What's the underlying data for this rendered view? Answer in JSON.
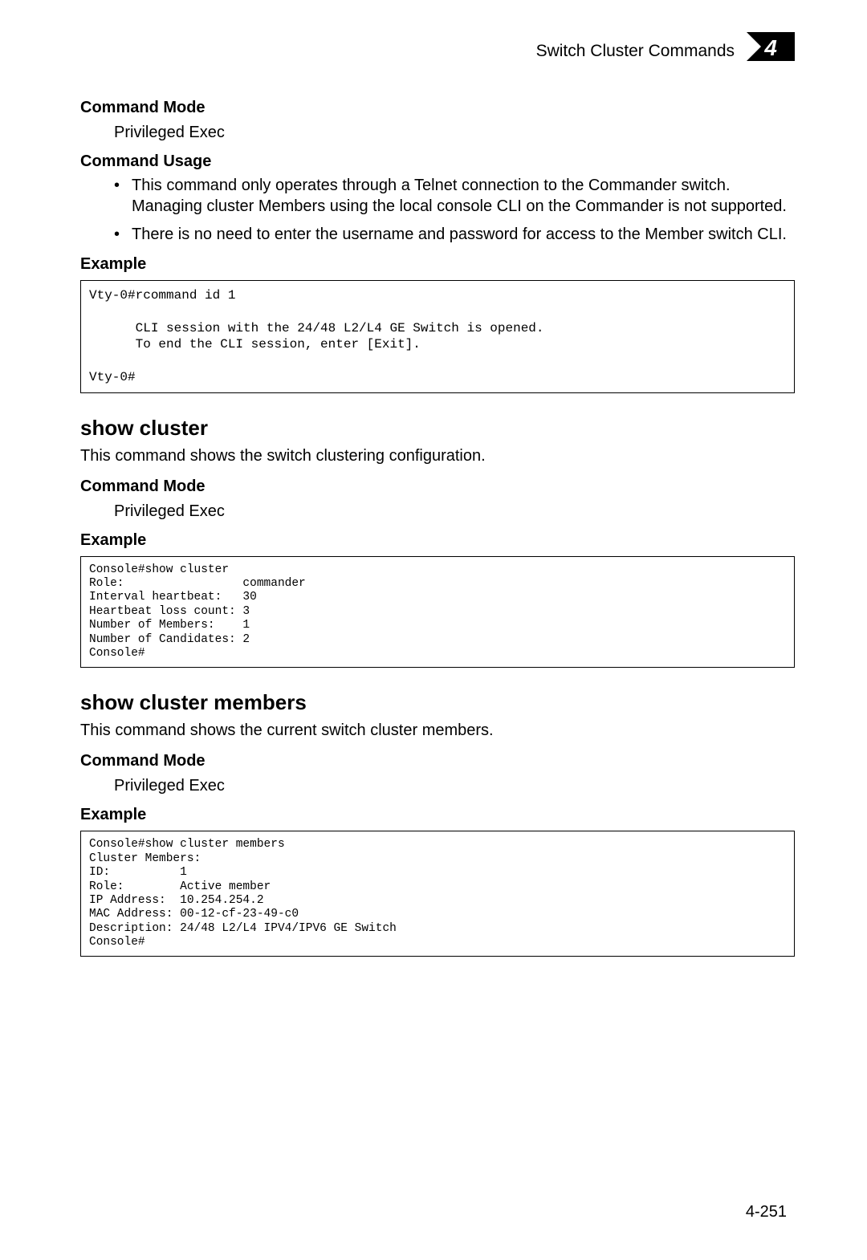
{
  "header": {
    "title": "Switch Cluster Commands",
    "chapter_number": "4"
  },
  "section1": {
    "command_mode_label": "Command Mode",
    "command_mode_value": "Privileged Exec",
    "command_usage_label": "Command Usage",
    "usage_bullets": [
      "This command only operates through a Telnet connection to the Commander switch. Managing cluster Members using the local console CLI on the Commander is not supported.",
      "There is no need to enter the username and password for access to the Member switch CLI."
    ],
    "example_label": "Example",
    "example_code": "Vty-0#rcommand id 1\n\n      CLI session with the 24/48 L2/L4 GE Switch is opened.\n      To end the CLI session, enter [Exit].\n\nVty-0#"
  },
  "section2": {
    "heading": "show cluster",
    "description": "This command shows the switch clustering configuration.",
    "command_mode_label": "Command Mode",
    "command_mode_value": "Privileged Exec",
    "example_label": "Example",
    "example_code": "Console#show cluster\nRole:                 commander\nInterval heartbeat:   30\nHeartbeat loss count: 3\nNumber of Members:    1\nNumber of Candidates: 2\nConsole#"
  },
  "section3": {
    "heading": "show cluster members",
    "description": "This command shows the current switch cluster members.",
    "command_mode_label": "Command Mode",
    "command_mode_value": "Privileged Exec",
    "example_label": "Example",
    "example_code": "Console#show cluster members\nCluster Members:\nID:          1\nRole:        Active member\nIP Address:  10.254.254.2\nMAC Address: 00-12-cf-23-49-c0\nDescription: 24/48 L2/L4 IPV4/IPV6 GE Switch\nConsole#"
  },
  "page_number": "4-251"
}
